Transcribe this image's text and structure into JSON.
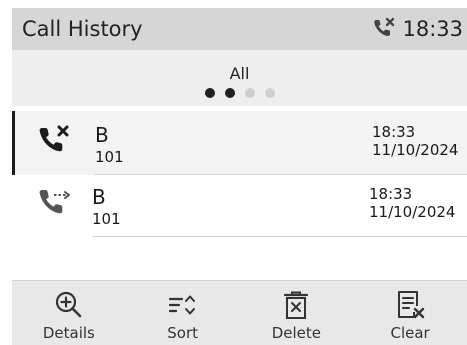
{
  "header": {
    "title": "Call History",
    "status_icon": "missed-call-icon",
    "clock": "18:33"
  },
  "filter": {
    "label": "All",
    "page_indicator": {
      "pages": 4,
      "active": [
        0,
        1
      ]
    }
  },
  "calls": [
    {
      "type": "missed",
      "icon": "missed-call-icon",
      "name": "B",
      "number": "101",
      "time": "18:33",
      "date": "11/10/2024",
      "selected": true
    },
    {
      "type": "forwarded",
      "icon": "forwarded-call-icon",
      "name": "B",
      "number": "101",
      "time": "18:33",
      "date": "11/10/2024",
      "selected": false
    }
  ],
  "softkeys": [
    {
      "label": "Details",
      "icon": "zoom-in-icon"
    },
    {
      "label": "Sort",
      "icon": "sort-icon"
    },
    {
      "label": "Delete",
      "icon": "trash-icon"
    },
    {
      "label": "Clear",
      "icon": "clear-list-icon"
    }
  ],
  "colors": {
    "title_bg": "#d6d6d6",
    "filter_bg": "#eeeeee",
    "softkey_bg": "#e8e8e8",
    "icon_dark": "#1c1c1c",
    "icon_gray": "#555555"
  }
}
